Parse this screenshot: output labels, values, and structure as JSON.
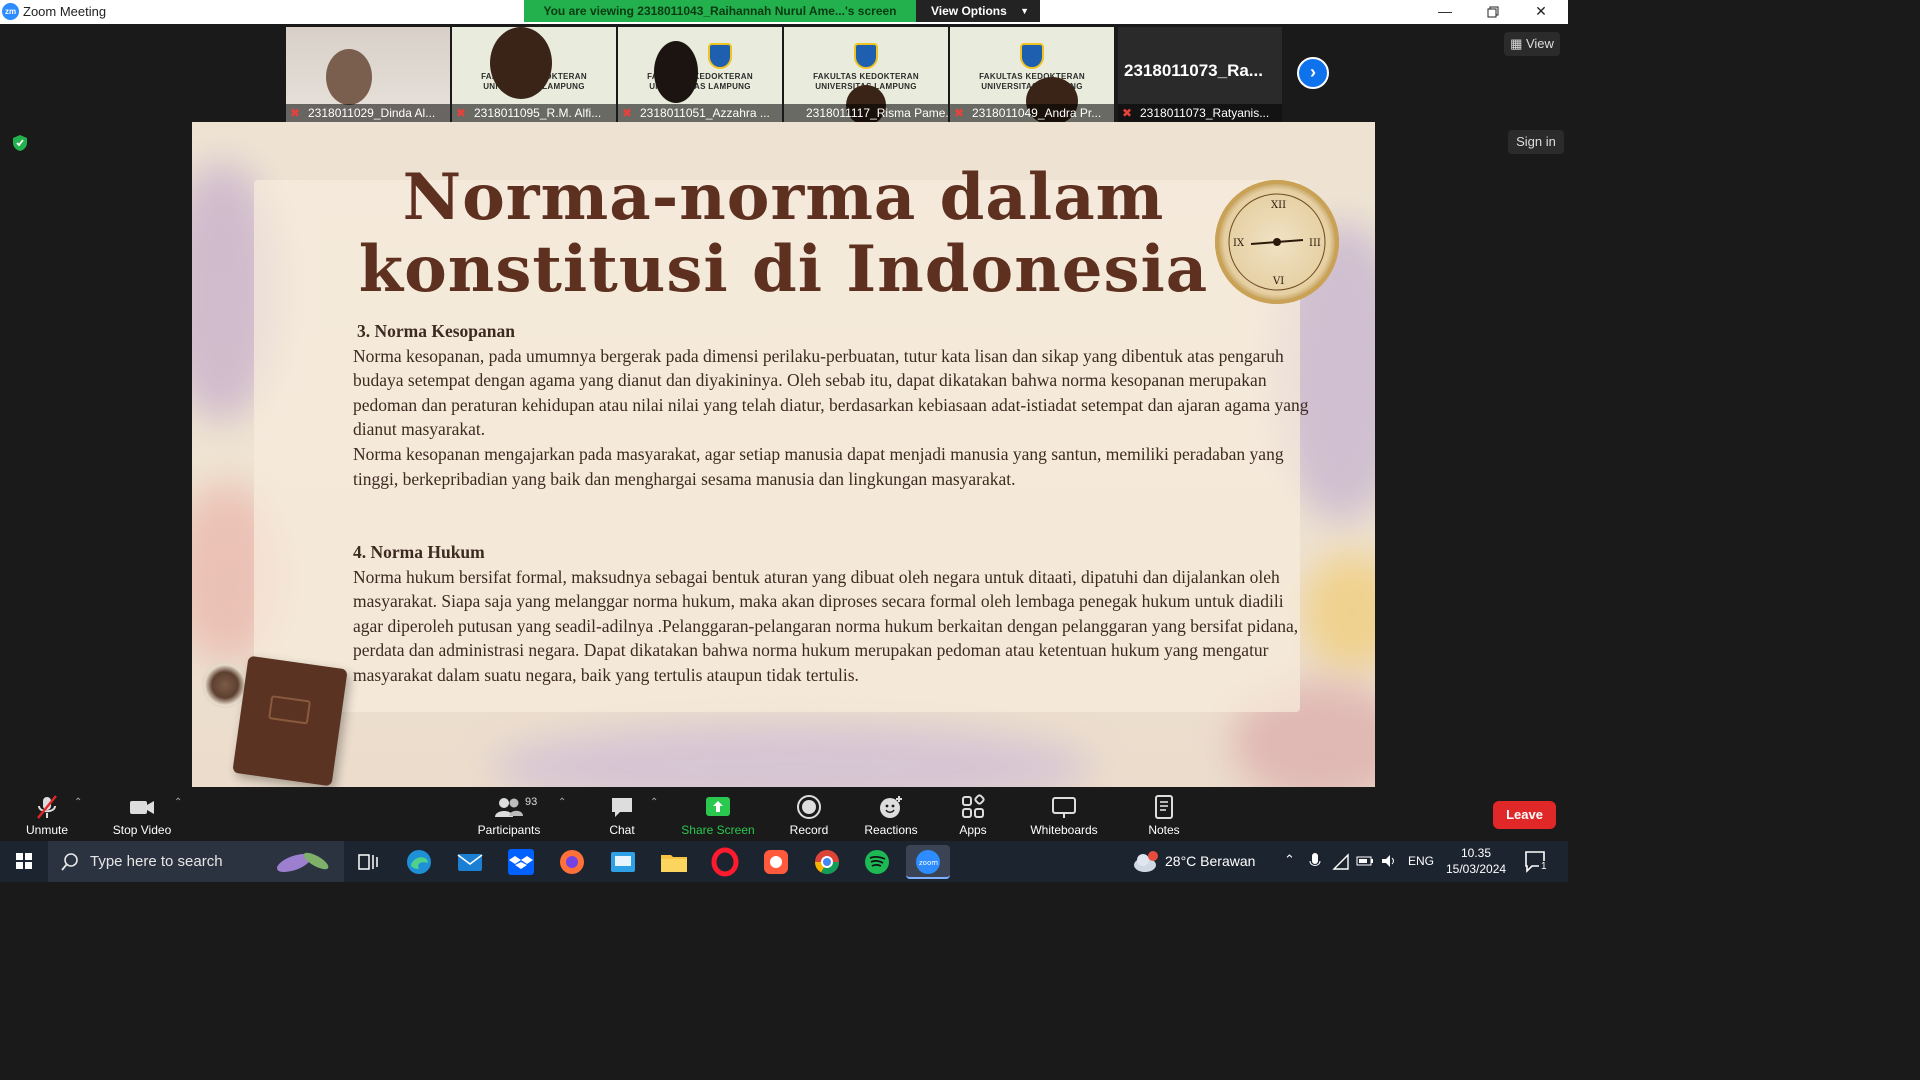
{
  "window": {
    "title": "Zoom Meeting",
    "app_icon_text": "zm"
  },
  "banner": {
    "viewing_text": "You are viewing 2318011043_Raihannah Nurul Ame...'s screen",
    "view_options_label": "View Options"
  },
  "filmstrip": {
    "tiles": [
      {
        "name": "2318011029_Dinda Al..."
      },
      {
        "name": "2318011095_R.M. Alfi..."
      },
      {
        "name": "2318011051_Azzahra ..."
      },
      {
        "name": "2318011117_Risma Pame..."
      },
      {
        "name": "2318011049_Andra Pr..."
      },
      {
        "name": "2318011073_Ratyanis...",
        "big_name": "2318011073_Ra..."
      }
    ],
    "background_text_line1": "FAKULTAS KEDOKTERAN",
    "background_text_line2": "UNIVERSITAS LAMPUNG",
    "next_icon": "chevron-right-icon"
  },
  "side": {
    "view_label": "View",
    "sign_in_label": "Sign in"
  },
  "slide": {
    "title_line1": "Norma-norma dalam",
    "title_line2": "konstitusi di Indonesia",
    "section3_heading": "3. Norma Kesopanan",
    "section3_p1": "Norma kesopanan, pada umumnya bergerak pada dimensi perilaku-perbuatan, tutur kata lisan dan sikap yang dibentuk atas pengaruh budaya setempat dengan agama yang dianut dan diyakininya. Oleh sebab itu, dapat dikatakan bahwa norma kesopanan merupakan pedoman dan peraturan kehidupan atau nilai nilai yang telah diatur, berdasarkan kebiasaan adat-istiadat setempat dan ajaran agama yang dianut masyarakat.",
    "section3_p2": "Norma kesopanan mengajarkan pada masyarakat, agar setiap manusia dapat menjadi manusia yang santun, memiliki peradaban yang tinggi, berkepribadian yang baik dan menghargai sesama manusia dan lingkungan masyarakat.",
    "section4_heading": "4. Norma Hukum",
    "section4_p1": "Norma hukum bersifat formal, maksudnya sebagai bentuk aturan yang dibuat oleh negara untuk ditaati, dipatuhi dan dijalankan oleh masyarakat. Siapa saja yang melanggar norma hukum, maka akan diproses secara formal oleh lembaga penegak hukum untuk diadili agar diperoleh putusan yang seadil-adilnya .Pelanggaran-pelangaran norma hukum berkaitan dengan pelanggaran yang bersifat pidana, perdata dan administrasi negara. Dapat dikatakan bahwa norma hukum merupakan pedoman atau ketentuan hukum yang mengatur masyarakat dalam suatu negara, baik yang tertulis ataupun tidak tertulis."
  },
  "toolbar": {
    "unmute": "Unmute",
    "stop_video": "Stop Video",
    "participants": "Participants",
    "participant_count": "93",
    "chat": "Chat",
    "share_screen": "Share Screen",
    "record": "Record",
    "reactions": "Reactions",
    "apps": "Apps",
    "whiteboards": "Whiteboards",
    "notes": "Notes",
    "leave": "Leave"
  },
  "taskbar": {
    "search_placeholder": "Type here to search",
    "weather": "28°C  Berawan",
    "language": "ENG",
    "time": "10.35",
    "date": "15/03/2024",
    "notification_count": "1"
  },
  "colors": {
    "accent_green": "#22b14c",
    "zoom_blue": "#0e72ed",
    "leave_red": "#e02828",
    "slide_title": "#5e3020"
  }
}
